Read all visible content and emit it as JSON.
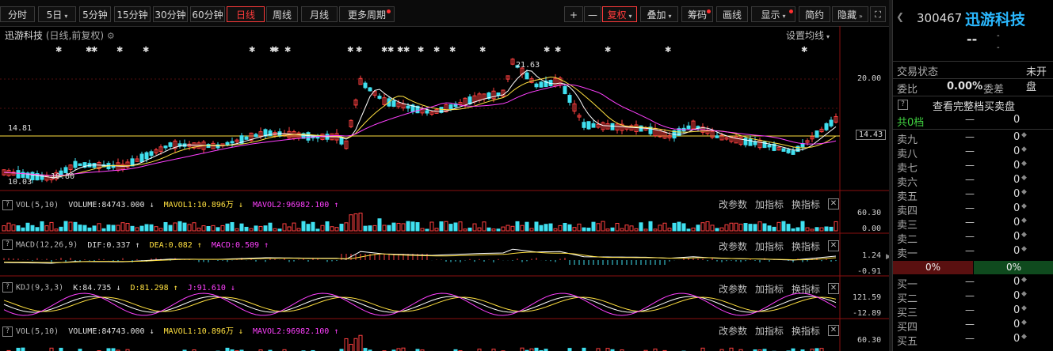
{
  "toolbar": {
    "periods": [
      "分时",
      "5日",
      "5分钟",
      "15分钟",
      "30分钟",
      "60分钟",
      "日线",
      "周线",
      "月线",
      "更多周期"
    ],
    "active_period": "日线",
    "right_buttons": [
      "+",
      "—",
      "复权",
      "叠加",
      "筹码",
      "画线",
      "显示",
      "简约",
      "隐藏"
    ]
  },
  "chart": {
    "title": "迅游科技",
    "subtitle": "(日线,前复权)",
    "ma_setting": "设置均线",
    "price_labels": {
      "high": "21.63",
      "low": "10.80",
      "left_level": "14.81",
      "left_low": "10.03",
      "axis_20": "20.00",
      "axis_current": "14.43"
    },
    "panels": [
      {
        "name": "VOL(5,10)",
        "items": [
          "VOLUME:84743.000 ↓",
          "MAVOL1:10.896万 ↓",
          "MAVOL2:96982.100 ↑"
        ],
        "axis": [
          "60.30",
          "0.00"
        ]
      },
      {
        "name": "MACD(12,26,9)",
        "items": [
          "DIF:0.337 ↑",
          "DEA:0.082 ↑",
          "MACD:0.509 ↑"
        ],
        "axis": [
          "1.24",
          "-0.91"
        ]
      },
      {
        "name": "KDJ(9,3,3)",
        "items": [
          "K:84.735 ↓",
          "D:81.298 ↑",
          "J:91.610 ↓"
        ],
        "axis": [
          "121.59",
          "-12.89"
        ]
      },
      {
        "name": "VOL(5,10)",
        "items": [
          "VOLUME:84743.000 ↓",
          "MAVOL1:10.896万 ↓",
          "MAVOL2:96982.100 ↑"
        ],
        "axis": [
          "60.30",
          ""
        ]
      }
    ],
    "panel_buttons": [
      "改参数",
      "加指标",
      "换指标"
    ]
  },
  "stock": {
    "code": "300467",
    "name": "迅游科技",
    "price": "--",
    "change": "-",
    "change_pct": "-"
  },
  "quote": {
    "status_label": "交易状态",
    "status_value": "未开盘",
    "wb_label": "委比",
    "wb_value": "0.00%",
    "wc_label": "委差",
    "full_book": "查看完整档买卖盘",
    "levels_label": "共0档",
    "levels_dash": "—",
    "levels_val": "0",
    "sell": [
      {
        "label": "卖九",
        "dash": "—",
        "val": "0"
      },
      {
        "label": "卖八",
        "dash": "—",
        "val": "0"
      },
      {
        "label": "卖七",
        "dash": "—",
        "val": "0"
      },
      {
        "label": "卖六",
        "dash": "—",
        "val": "0"
      },
      {
        "label": "卖五",
        "dash": "—",
        "val": "0"
      },
      {
        "label": "卖四",
        "dash": "—",
        "val": "0"
      },
      {
        "label": "卖三",
        "dash": "—",
        "val": "0"
      },
      {
        "label": "卖二",
        "dash": "—",
        "val": "0"
      },
      {
        "label": "卖一",
        "dash": "—",
        "val": "0"
      }
    ],
    "ratio_sell": "0%",
    "ratio_buy": "0%",
    "buy": [
      {
        "label": "买一",
        "dash": "—",
        "val": "0"
      },
      {
        "label": "买二",
        "dash": "—",
        "val": "0"
      },
      {
        "label": "买三",
        "dash": "—",
        "val": "0"
      },
      {
        "label": "买四",
        "dash": "—",
        "val": "0"
      },
      {
        "label": "买五",
        "dash": "—",
        "val": "0"
      }
    ]
  },
  "colors": {
    "up": "#ff4040",
    "down": "#40e0f0",
    "ma5": "#ffffff",
    "ma10": "#ffe040",
    "ma20": "#ff40ff",
    "accent": "#ff3b3b",
    "stock_name": "#2ab8ff"
  }
}
